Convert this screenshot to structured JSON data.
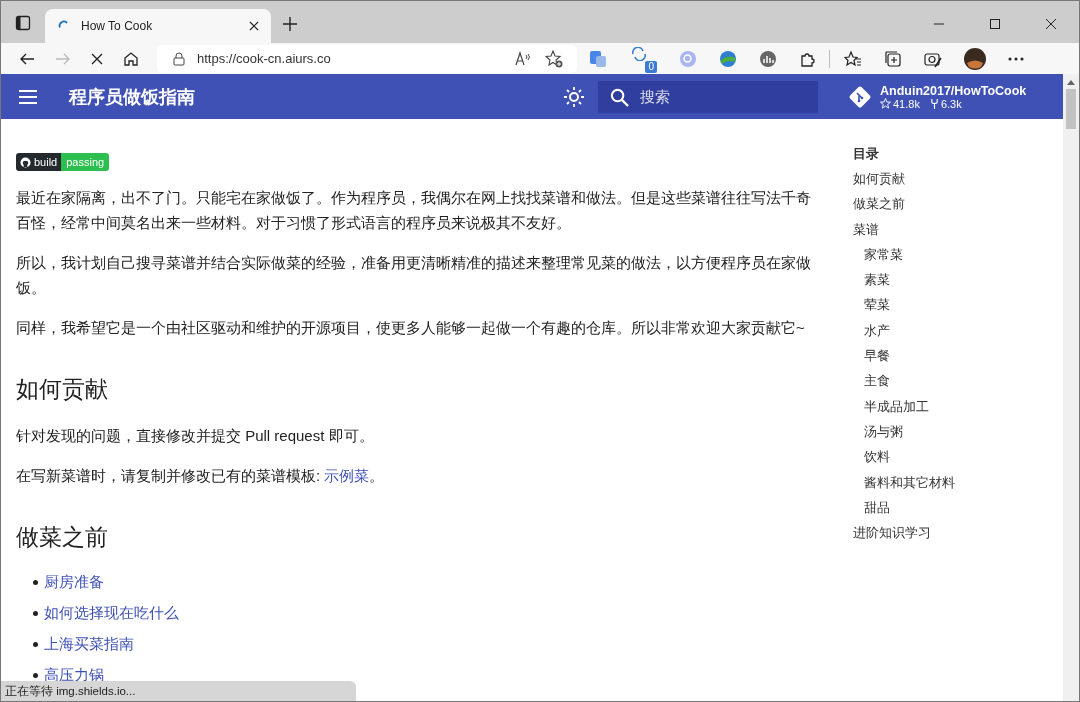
{
  "browser": {
    "tab": {
      "title": "How To Cook"
    },
    "address": "https://cook-cn.aiurs.co",
    "extension_badge": "0",
    "status": "正在等待 img.shields.io..."
  },
  "site": {
    "title": "程序员做饭指南",
    "search_placeholder": "搜索",
    "repo": {
      "name": "Anduin2017/HowToCook",
      "stars": "41.8k",
      "forks": "6.3k"
    }
  },
  "build_badge": {
    "label": "build",
    "status": "passing"
  },
  "content": [
    {
      "kind": "paragraph",
      "text": "最近在家隔离，出不了门。只能宅在家做饭了。作为程序员，我偶尔在网上找找菜谱和做法。但是这些菜谱往往写法千奇百怪，经常中间莫名出来一些材料。对于习惯了形式语言的程序员来说极其不友好。"
    },
    {
      "kind": "paragraph",
      "text": "所以，我计划自己搜寻菜谱并结合实际做菜的经验，准备用更清晰精准的描述来整理常见菜的做法，以方便程序员在家做饭。"
    },
    {
      "kind": "paragraph",
      "text": "同样，我希望它是一个由社区驱动和维护的开源项目，使更多人能够一起做一个有趣的仓库。所以非常欢迎大家贡献它~"
    },
    {
      "kind": "heading",
      "text": "如何贡献"
    },
    {
      "kind": "paragraph",
      "text": "针对发现的问题，直接修改并提交 Pull request 即可。"
    },
    {
      "kind": "paragraph",
      "text": "在写新菜谱时，请复制并修改已有的菜谱模板: ",
      "link": "示例菜",
      "after": "。"
    },
    {
      "kind": "heading",
      "text": "做菜之前"
    },
    {
      "kind": "list",
      "items": [
        "厨房准备",
        "如何选择现在吃什么",
        "上海买菜指南",
        "高压力锅"
      ]
    }
  ],
  "toc": {
    "title": "目录",
    "items": [
      {
        "label": "如何贡献"
      },
      {
        "label": "做菜之前"
      },
      {
        "label": "菜谱",
        "children": [
          {
            "label": "家常菜"
          },
          {
            "label": "素菜"
          },
          {
            "label": "荤菜"
          },
          {
            "label": "水产"
          },
          {
            "label": "早餐"
          },
          {
            "label": "主食"
          },
          {
            "label": "半成品加工"
          },
          {
            "label": "汤与粥"
          },
          {
            "label": "饮料"
          },
          {
            "label": "酱料和其它材料"
          },
          {
            "label": "甜品"
          }
        ]
      },
      {
        "label": "进阶知识学习"
      }
    ]
  }
}
